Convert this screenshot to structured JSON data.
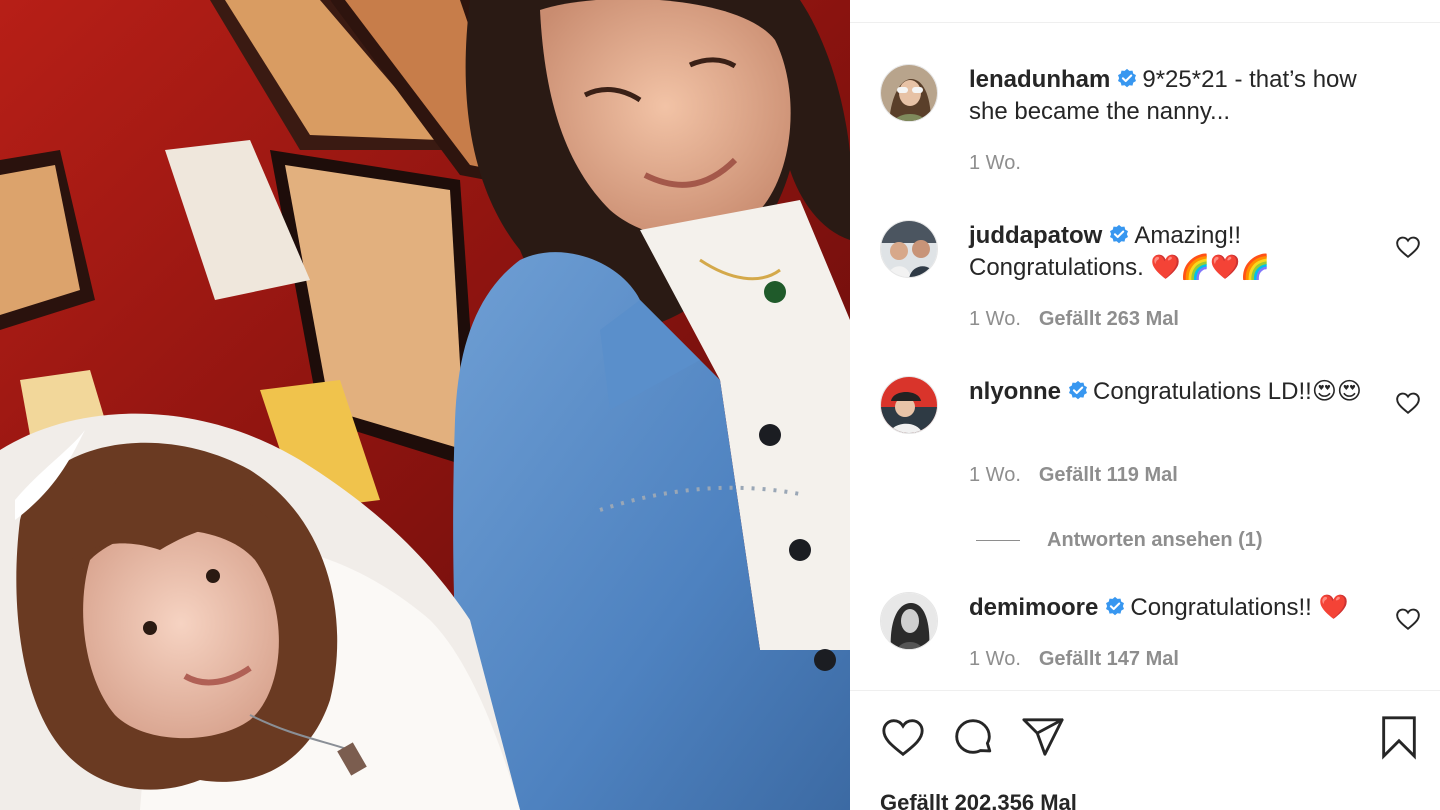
{
  "post": {
    "image_icon": "wedding-photo",
    "caption": {
      "username": "lenadunham",
      "text": "9*25*21 - that’s how she became the nanny...",
      "time": "1 Wo."
    },
    "comments": [
      {
        "username": "juddapatow",
        "text": "Amazing!! Congratulations.",
        "emoji": "❤️🌈❤️🌈",
        "time": "1 Wo.",
        "likes": "Gefällt 263 Mal"
      },
      {
        "username": "nlyonne",
        "text": "Congratulations LD!!",
        "emoji": "😍😍",
        "time": "1 Wo.",
        "likes": "Gefällt 119 Mal",
        "replies": "Antworten ansehen (1)"
      },
      {
        "username": "demimoore",
        "text": "Congratulations!!",
        "emoji": "❤️",
        "time": "1 Wo.",
        "likes": "Gefällt 147 Mal"
      }
    ],
    "likes_total": "Gefällt 202.356 Mal",
    "icons": {
      "like": "heart-icon",
      "comment": "comment-icon",
      "share": "paper-plane-icon",
      "save": "bookmark-icon",
      "verified": "verified-badge-icon"
    },
    "colors": {
      "verified": "#3897f0",
      "heart_red": "#ed1b24",
      "muted_text": "#8e8e8e"
    }
  }
}
